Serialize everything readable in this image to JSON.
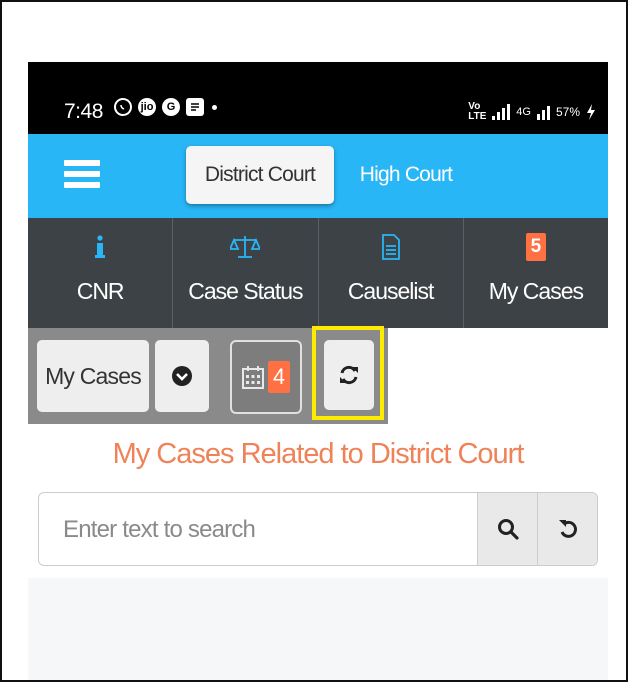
{
  "status_bar": {
    "time": "7:48",
    "icons": [
      "whatsapp-icon",
      "jio-icon",
      "g-icon",
      "app-icon",
      "dot-icon"
    ],
    "network": "Vo LTE",
    "signal_type": "4G",
    "battery": "57%"
  },
  "nav": {
    "tabs": [
      {
        "label": "District Court",
        "active": true
      },
      {
        "label": "High Court",
        "active": false
      }
    ],
    "accent_color": "#29b6f6"
  },
  "menu": {
    "items": [
      {
        "label": "CNR",
        "icon": "info-icon"
      },
      {
        "label": "Case Status",
        "icon": "balance-scale-icon"
      },
      {
        "label": "Causelist",
        "icon": "document-icon"
      },
      {
        "label": "My Cases",
        "icon": "count-badge",
        "badge": "5"
      }
    ]
  },
  "toolbar": {
    "my_cases_label": "My Cases",
    "dropdown_icon": "chevron-circle-down-icon",
    "calendar_icon": "calendar-icon",
    "calendar_count": "4",
    "refresh_icon": "refresh-icon",
    "highlight_color": "#ffeb00"
  },
  "main": {
    "heading": "My Cases Related to District Court",
    "search": {
      "placeholder": "Enter text to search",
      "value": "",
      "search_icon": "search-icon",
      "reset_icon": "reset-icon"
    }
  }
}
